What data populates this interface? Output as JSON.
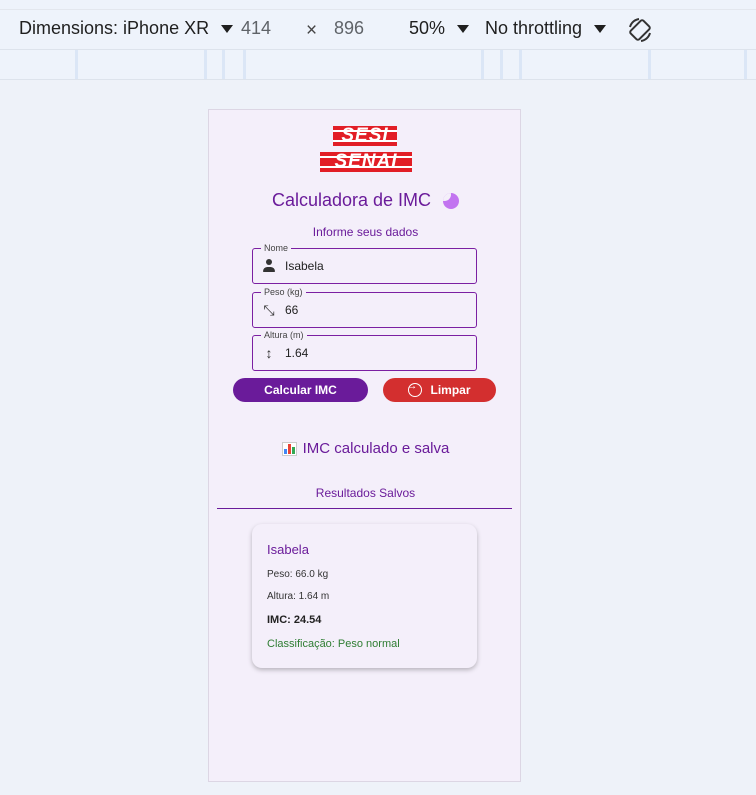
{
  "devtools": {
    "dimensions_label": "Dimensions: iPhone XR",
    "width": "414",
    "times": "×",
    "height": "896",
    "zoom": "50%",
    "throttling": "No throttling"
  },
  "app": {
    "logo_line1": "SESI",
    "logo_line2": "SENAI",
    "title": "Calculadora de IMC",
    "subtitle": "Informe seus dados",
    "fields": {
      "nome": {
        "label": "Nome",
        "value": "Isabela"
      },
      "peso": {
        "label": "Peso (kg)",
        "value": "66"
      },
      "altura": {
        "label": "Altura (m)",
        "value": "1.64"
      }
    },
    "calc_button": "Calcular IMC",
    "clear_button": "Limpar",
    "status_message": "IMC calculado e salva",
    "results_title": "Resultados Salvos",
    "result": {
      "name": "Isabela",
      "peso": "Peso: 66.0 kg",
      "altura": "Altura: 1.64 m",
      "imc": "IMC: 24.54",
      "classificacao": "Classificação: Peso normal"
    }
  },
  "colors": {
    "primary": "#6a1b9a",
    "danger": "#d32f2f",
    "success": "#2e7d32",
    "logo_red": "#e21e26"
  }
}
